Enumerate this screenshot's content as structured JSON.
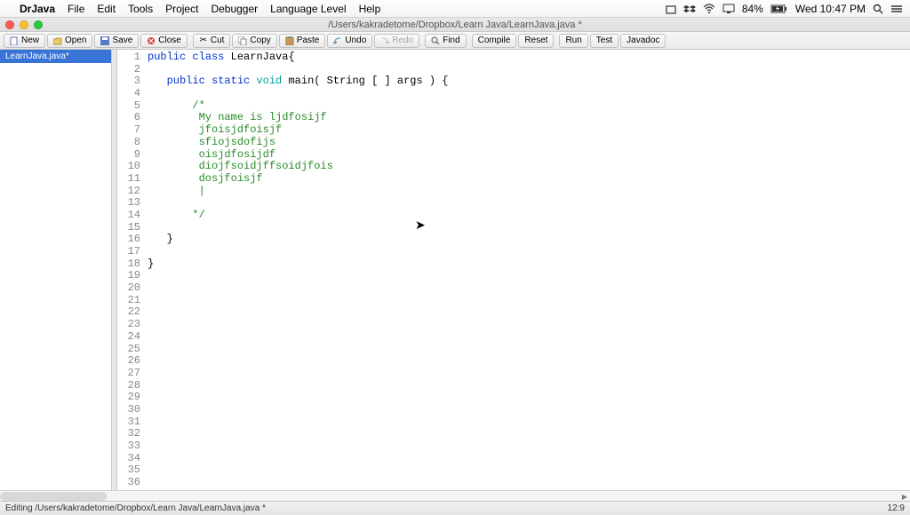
{
  "menubar": {
    "app_name": "DrJava",
    "items": [
      "File",
      "Edit",
      "Tools",
      "Project",
      "Debugger",
      "Language Level",
      "Help"
    ],
    "battery": "84%",
    "clock": "Wed 10:47 PM"
  },
  "window": {
    "title": "/Users/kakradetome/Dropbox/Learn Java/LearnJava.java *"
  },
  "toolbar": {
    "new": "New",
    "open": "Open",
    "save": "Save",
    "close": "Close",
    "cut": "Cut",
    "copy": "Copy",
    "paste": "Paste",
    "undo": "Undo",
    "redo": "Redo",
    "find": "Find",
    "compile": "Compile",
    "reset": "Reset",
    "run": "Run",
    "test": "Test",
    "javadoc": "Javadoc"
  },
  "sidebar": {
    "file": "LearnJava.java*"
  },
  "code": {
    "lines": [
      {
        "n": 1,
        "segs": [
          {
            "t": "public ",
            "c": "kw-blue"
          },
          {
            "t": "class ",
            "c": "kw-blue"
          },
          {
            "t": "LearnJava{",
            "c": ""
          }
        ]
      },
      {
        "n": 2,
        "segs": []
      },
      {
        "n": 3,
        "segs": [
          {
            "t": "   ",
            "c": ""
          },
          {
            "t": "public ",
            "c": "kw-blue"
          },
          {
            "t": "static ",
            "c": "kw-blue"
          },
          {
            "t": "void ",
            "c": "kw-teal"
          },
          {
            "t": "main( String [ ] args ) {",
            "c": ""
          }
        ]
      },
      {
        "n": 4,
        "segs": []
      },
      {
        "n": 5,
        "segs": [
          {
            "t": "       /*",
            "c": "comment"
          }
        ]
      },
      {
        "n": 6,
        "segs": [
          {
            "t": "        My name is ljdfosijf",
            "c": "comment"
          }
        ]
      },
      {
        "n": 7,
        "segs": [
          {
            "t": "        jfoisjdfoisjf",
            "c": "comment"
          }
        ]
      },
      {
        "n": 8,
        "segs": [
          {
            "t": "        sfiojsdofijs",
            "c": "comment"
          }
        ]
      },
      {
        "n": 9,
        "segs": [
          {
            "t": "        oisjdfosijdf",
            "c": "comment"
          }
        ]
      },
      {
        "n": 10,
        "segs": [
          {
            "t": "        diojfsoidjffsoidjfois",
            "c": "comment"
          }
        ]
      },
      {
        "n": 11,
        "segs": [
          {
            "t": "        dosjfoisjf",
            "c": "comment"
          }
        ]
      },
      {
        "n": 12,
        "segs": [
          {
            "t": "        |",
            "c": "comment"
          }
        ]
      },
      {
        "n": 13,
        "segs": []
      },
      {
        "n": 14,
        "segs": [
          {
            "t": "       */",
            "c": "comment"
          }
        ]
      },
      {
        "n": 15,
        "segs": []
      },
      {
        "n": 16,
        "segs": [
          {
            "t": "   }",
            "c": ""
          }
        ]
      },
      {
        "n": 17,
        "segs": []
      },
      {
        "n": 18,
        "segs": [
          {
            "t": "}",
            "c": ""
          }
        ]
      },
      {
        "n": 19,
        "segs": []
      },
      {
        "n": 20,
        "segs": []
      },
      {
        "n": 21,
        "segs": []
      },
      {
        "n": 22,
        "segs": []
      },
      {
        "n": 23,
        "segs": []
      },
      {
        "n": 24,
        "segs": []
      },
      {
        "n": 25,
        "segs": []
      },
      {
        "n": 26,
        "segs": []
      },
      {
        "n": 27,
        "segs": []
      },
      {
        "n": 28,
        "segs": []
      },
      {
        "n": 29,
        "segs": []
      },
      {
        "n": 30,
        "segs": []
      },
      {
        "n": 31,
        "segs": []
      },
      {
        "n": 32,
        "segs": []
      },
      {
        "n": 33,
        "segs": []
      },
      {
        "n": 34,
        "segs": []
      },
      {
        "n": 35,
        "segs": []
      },
      {
        "n": 36,
        "segs": []
      }
    ]
  },
  "status": {
    "left": "Editing /Users/kakradetome/Dropbox/Learn Java/LearnJava.java *",
    "right": "12:9"
  }
}
